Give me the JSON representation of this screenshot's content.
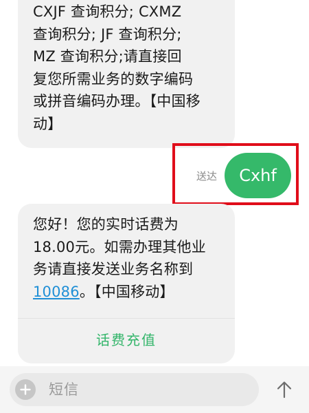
{
  "messages": [
    {
      "direction": "incoming",
      "lines": [
        "CXJF 查询积分; CXMZ",
        "查询积分; JF 查询积分;",
        "MZ 查询积分;请直接回",
        "复您所需业务的数字编码",
        "或拼音编码办理。【中国移",
        "动】"
      ]
    },
    {
      "direction": "outgoing",
      "text": "Cxhf",
      "status": "送达"
    },
    {
      "direction": "incoming",
      "text_part1": "您好！您的实时话费为",
      "text_part2": "18.00元。如需办理其他业",
      "text_part3": "务请直接发送业务名称到",
      "link_number": "10086",
      "text_suffix": "。【中国移动】",
      "action_label": "话费充值"
    }
  ],
  "composer": {
    "placeholder": "短信"
  },
  "colors": {
    "outgoing_bubble": "#35b96a",
    "incoming_bubble": "#f1f1f1",
    "highlight_box": "#e00d1a",
    "link": "#1f8fd6",
    "action_text": "#33b56a"
  },
  "icons": {
    "add": "plus-icon",
    "send": "arrow-up-icon"
  }
}
